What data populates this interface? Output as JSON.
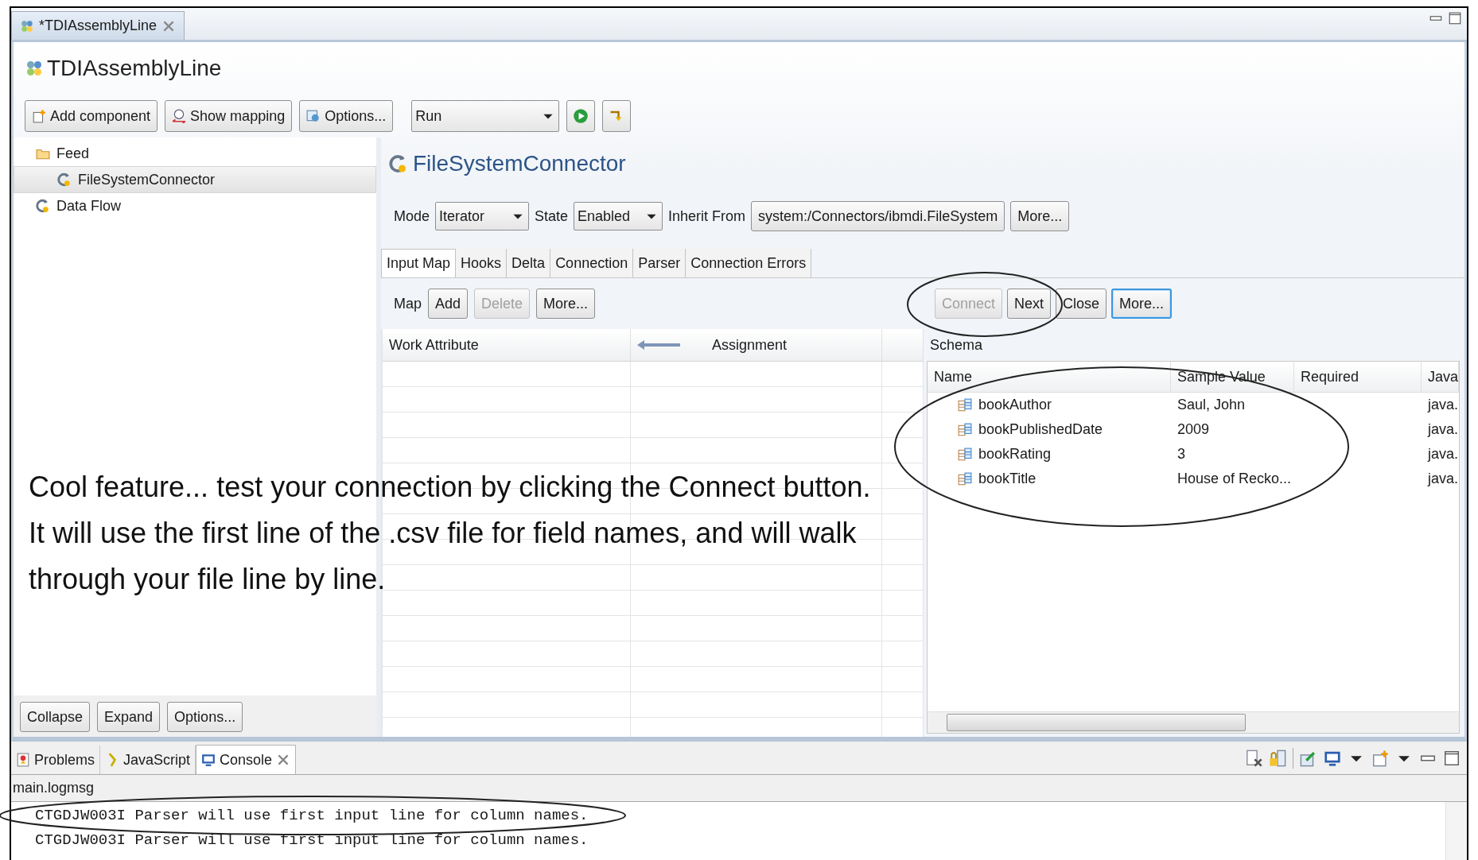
{
  "editor_tab": {
    "title": "*TDIAssemblyLine",
    "selected": true
  },
  "title": "TDIAssemblyLine",
  "toolbar": {
    "buttons": [
      "Add component",
      "Show mapping",
      "Options..."
    ],
    "run_combo": "Run"
  },
  "tree": [
    {
      "label": "Feed",
      "selected": false,
      "children": [
        {
          "label": "FileSystemConnector",
          "selected": true
        }
      ]
    },
    {
      "label": "Data Flow",
      "selected": false
    }
  ],
  "tree_buttons": [
    "Collapse",
    "Expand",
    "Options..."
  ],
  "connector": {
    "title": "FileSystemConnector",
    "mode_label": "Mode",
    "mode": "Iterator",
    "state_label": "State",
    "state": "Enabled",
    "inherit_label": "Inherit From",
    "inherit": "system:/Connectors/ibmdi.FileSystem",
    "more": "More..."
  },
  "tabs": [
    {
      "label": "Input Map",
      "selected": true
    },
    {
      "label": "Hooks",
      "selected": false
    },
    {
      "label": "Delta",
      "selected": false
    },
    {
      "label": "Connection",
      "selected": false
    },
    {
      "label": "Parser",
      "selected": false
    },
    {
      "label": "Connection Errors",
      "selected": false
    }
  ],
  "map_bar": {
    "label": "Map",
    "buttons": [
      {
        "label": "Add",
        "disabled": false
      },
      {
        "label": "Delete",
        "disabled": true
      },
      {
        "label": "More...",
        "disabled": false
      }
    ]
  },
  "schema_buttons": [
    {
      "label": "Connect",
      "disabled": true,
      "focused": false
    },
    {
      "label": "Next",
      "disabled": false,
      "focused": false
    },
    {
      "label": "Close",
      "disabled": false,
      "focused": false
    },
    {
      "label": "More...",
      "disabled": false,
      "focused": true
    }
  ],
  "map_table": {
    "columns": [
      "Work Attribute",
      "Assignment"
    ]
  },
  "schema": {
    "label": "Schema",
    "columns": [
      "Name",
      "Sample Value",
      "Required",
      "Java"
    ],
    "rows": [
      {
        "name": "bookAuthor",
        "sample_value": "Saul, John",
        "java": "java."
      },
      {
        "name": "bookPublishedDate",
        "sample_value": "2009",
        "java": "java."
      },
      {
        "name": "bookRating",
        "sample_value": "3",
        "java": "java."
      },
      {
        "name": "bookTitle",
        "sample_value": "House of Recko...",
        "java": "java."
      }
    ]
  },
  "bottom_tabs": [
    {
      "label": "Problems",
      "selected": false
    },
    {
      "label": "JavaScript",
      "selected": false
    },
    {
      "label": "Console",
      "selected": true
    }
  ],
  "console": {
    "title": "main.logmsg",
    "lines": [
      "CTGDJW003I Parser will use first input line for column names.",
      "CTGDJW003I Parser will use first input line for column names."
    ]
  },
  "callout": "Cool feature... test your connection by clicking the Connect button. It will use the first line of the .csv file for field names, and will walk through your file line by line."
}
